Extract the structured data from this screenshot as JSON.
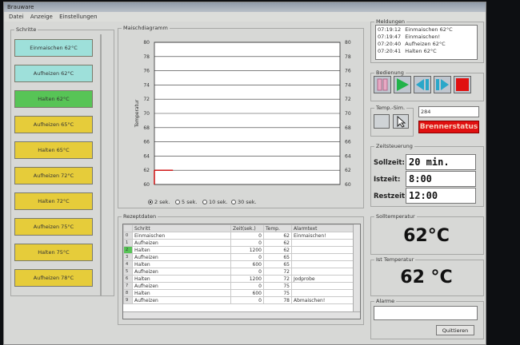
{
  "window": {
    "title": "Brauware"
  },
  "menu": [
    "Datei",
    "Anzeige",
    "Einstellungen"
  ],
  "schritte": {
    "legend": "Schritte",
    "items": [
      {
        "label": "Einmaischen 62°C",
        "color": "cyan"
      },
      {
        "label": "Aufheizen 62°C",
        "color": "cyan"
      },
      {
        "label": "Halten 62°C",
        "color": "green"
      },
      {
        "label": "Aufheizen 65°C",
        "color": "yellow"
      },
      {
        "label": "Halten 65°C",
        "color": "yellow"
      },
      {
        "label": "Aufheizen 72°C",
        "color": "yellow"
      },
      {
        "label": "Halten 72°C",
        "color": "yellow"
      },
      {
        "label": "Aufheizen 75°C",
        "color": "yellow"
      },
      {
        "label": "Halten 75°C",
        "color": "yellow"
      },
      {
        "label": "Aufheizen 78°C",
        "color": "yellow"
      }
    ]
  },
  "chart_panel": {
    "legend": "Maischdiagramm"
  },
  "chart_data": {
    "type": "line",
    "ylabel": "Temperatur",
    "ylim": [
      60,
      80
    ],
    "yticks": [
      60,
      62,
      64,
      66,
      68,
      70,
      72,
      74,
      76,
      78,
      80
    ],
    "series": [
      {
        "values": [
          [
            0,
            62
          ],
          [
            0.1,
            62
          ]
        ],
        "color": "#cc0000"
      }
    ],
    "grid": true
  },
  "intervals": {
    "options": [
      "2 sek.",
      "5 sek.",
      "10 sek.",
      "30 sek."
    ],
    "selected": 0
  },
  "rezept": {
    "legend": "Rezeptdaten",
    "columns": [
      "Schritt",
      "Zeit(sek.)",
      "Temp.",
      "Alarmtext"
    ],
    "rows": [
      {
        "n": "0",
        "schritt": "Einmaischen",
        "zeit": "0",
        "temp": "62",
        "alarm": "Einmaischen!"
      },
      {
        "n": "1",
        "schritt": "Aufheizen",
        "zeit": "0",
        "temp": "62",
        "alarm": ""
      },
      {
        "n": "2",
        "schritt": "Halten",
        "zeit": "1200",
        "temp": "62",
        "alarm": ""
      },
      {
        "n": "3",
        "schritt": "Aufheizen",
        "zeit": "0",
        "temp": "65",
        "alarm": ""
      },
      {
        "n": "4",
        "schritt": "Halten",
        "zeit": "600",
        "temp": "65",
        "alarm": ""
      },
      {
        "n": "5",
        "schritt": "Aufheizen",
        "zeit": "0",
        "temp": "72",
        "alarm": ""
      },
      {
        "n": "6",
        "schritt": "Halten",
        "zeit": "1200",
        "temp": "72",
        "alarm": "Jodprobe"
      },
      {
        "n": "7",
        "schritt": "Aufheizen",
        "zeit": "0",
        "temp": "75",
        "alarm": ""
      },
      {
        "n": "8",
        "schritt": "Halten",
        "zeit": "600",
        "temp": "75",
        "alarm": ""
      },
      {
        "n": "9",
        "schritt": "Aufheizen",
        "zeit": "0",
        "temp": "78",
        "alarm": "Abmaischen!"
      }
    ]
  },
  "meldungen": {
    "legend": "Meldungen",
    "items": [
      {
        "time": "07:19:12",
        "text": "Einmaischen 62°C"
      },
      {
        "time": "07:19:47",
        "text": "Einmaischen!"
      },
      {
        "time": "07:20:40",
        "text": "Aufheizen 62°C"
      },
      {
        "time": "07:20:41",
        "text": "Halten 62°C"
      }
    ]
  },
  "bedienung": {
    "legend": "Bedienung"
  },
  "tempsim": {
    "legend": "Temp.-Sim.",
    "value": "284"
  },
  "brenner": {
    "label": "Brennerstatus"
  },
  "zeit": {
    "legend": "Zeitsteuerung",
    "soll_label": "Sollzeit:",
    "soll_value": "20 min.",
    "ist_label": "Istzeit:",
    "ist_value": "8:00",
    "rest_label": "Restzeit:",
    "rest_value": "12:00"
  },
  "solltemp": {
    "legend": "Solltemperatur",
    "value": "62°C"
  },
  "isttemp": {
    "legend": "Ist Temperatur",
    "value": "62 °C"
  },
  "alarme": {
    "legend": "Alarme",
    "quit_label": "Quittieren"
  },
  "colors": {
    "cyan": "#9ee0da",
    "green": "#57c456",
    "yellow": "#e6cc3a",
    "red": "#e01010",
    "accent_green": "#21b34a",
    "accent_cyan": "#2aa7c9",
    "pink": "#e8a9c4"
  }
}
